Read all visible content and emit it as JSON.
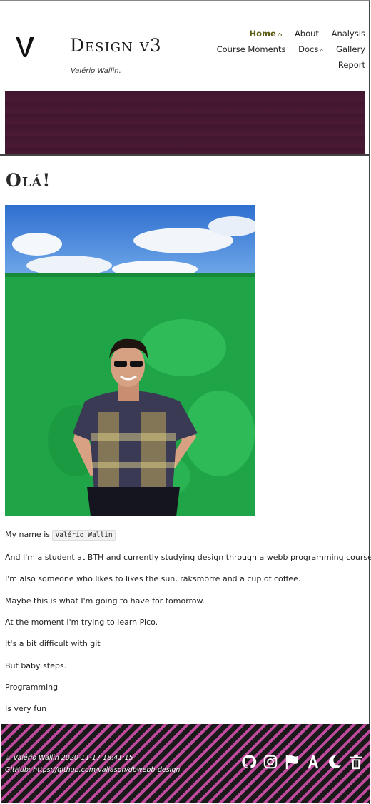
{
  "header": {
    "site_title": "Design v3",
    "site_subtitle": "Valério Wallin.",
    "logo_icon": "v-logo-icon"
  },
  "nav": {
    "items": [
      {
        "label": "Home",
        "icon": "home-icon",
        "icon_glyph": "⌂",
        "active": true
      },
      {
        "label": "About"
      },
      {
        "label": "Analysis"
      },
      {
        "label": "Course Moments"
      },
      {
        "label": "Docs",
        "icon": "search-icon",
        "icon_glyph": "⌕"
      },
      {
        "label": "Gallery"
      },
      {
        "label": "Report"
      }
    ]
  },
  "main": {
    "greeting": "Olá!",
    "intro_prefix": "My name is",
    "intro_name": "Valério Wallin",
    "paragraphs": [
      "And I'm a student at BTH and currently studying design through a webb programming course.",
      "I'm also someone who likes to likes the sun, räksmörre and a cup of coffee.",
      "Maybe this is what I'm going to have for tomorrow.",
      "At the moment I'm trying to learn Pico.",
      "It's a bit difficult with git",
      "But baby steps.",
      "Programming",
      "Is very fun"
    ]
  },
  "footer": {
    "line1": "Valério Wallin 2020-11-17 18:41:15",
    "line2": "GitHub: https://github.com/valjason/dbwebb-design",
    "icons": [
      "coffee-icon",
      "github-icon",
      "instagram-icon",
      "flag-icon",
      "font-size-icon",
      "moon-icon",
      "trash-icon"
    ]
  },
  "colors": {
    "banner": "#4b1a35",
    "footer_stripe_dark": "#1a1a1a",
    "footer_stripe_pink": "#c04b9e",
    "photo_wall": "#20a04a",
    "nav_active": "#5a5a10"
  }
}
